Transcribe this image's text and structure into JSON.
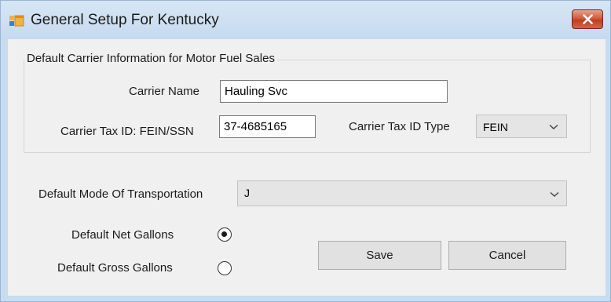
{
  "window": {
    "title": "General Setup For Kentucky",
    "icons": {
      "app": "windows-form-icon",
      "close": "close-x-icon"
    },
    "colors": {
      "close_button": "#c94a2c",
      "title_bar": "#cfe0f3",
      "client": "#f0f0f0"
    }
  },
  "carrier_group": {
    "legend": "Default Carrier Information for Motor Fuel Sales",
    "carrier_name": {
      "label": "Carrier Name",
      "value": "Hauling Svc"
    },
    "carrier_tax_id": {
      "label": "Carrier Tax ID: FEIN/SSN",
      "value": "37-4685165"
    },
    "carrier_tax_id_type": {
      "label": "Carrier Tax ID Type",
      "selected": "FEIN",
      "icon": "chevron-down-icon"
    }
  },
  "mode_of_transportation": {
    "label": "Default Mode Of Transportation",
    "selected": "J",
    "icon": "chevron-down-icon"
  },
  "gallons": {
    "net": {
      "label": "Default Net Gallons",
      "checked": true
    },
    "gross": {
      "label": "Default Gross Gallons",
      "checked": false
    }
  },
  "buttons": {
    "save": "Save",
    "cancel": "Cancel"
  }
}
